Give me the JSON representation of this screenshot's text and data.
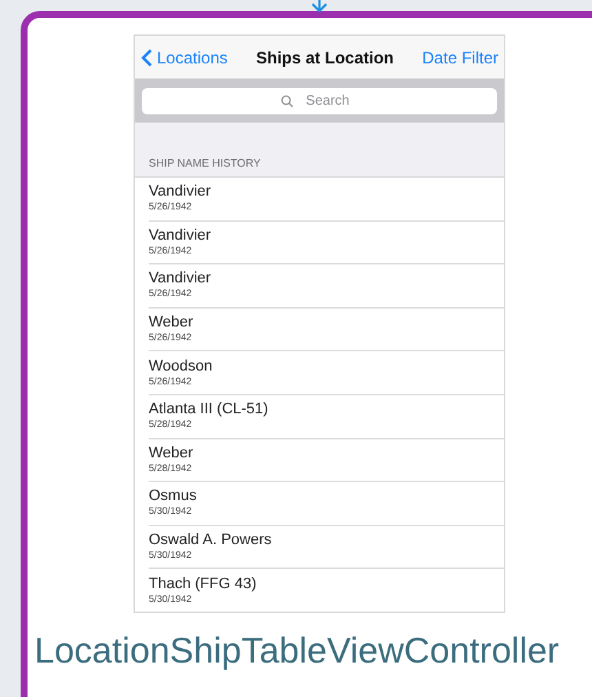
{
  "nav": {
    "back": "Locations",
    "title": "Ships at Location",
    "action": "Date Filter"
  },
  "search": {
    "placeholder": "Search"
  },
  "section": {
    "header": "SHIP NAME HISTORY"
  },
  "rows": [
    {
      "name": "Vandivier",
      "date": "5/26/1942"
    },
    {
      "name": "Vandivier",
      "date": "5/26/1942"
    },
    {
      "name": "Vandivier",
      "date": "5/26/1942"
    },
    {
      "name": "Weber",
      "date": "5/26/1942"
    },
    {
      "name": "Woodson",
      "date": "5/26/1942"
    },
    {
      "name": "Atlanta III (CL-51)",
      "date": "5/28/1942"
    },
    {
      "name": "Weber",
      "date": "5/28/1942"
    },
    {
      "name": "Osmus",
      "date": "5/30/1942"
    },
    {
      "name": "Oswald A. Powers",
      "date": "5/30/1942"
    },
    {
      "name": "Thach (FFG 43)",
      "date": "5/30/1942"
    }
  ],
  "caption": "LocationShipTableViewController"
}
